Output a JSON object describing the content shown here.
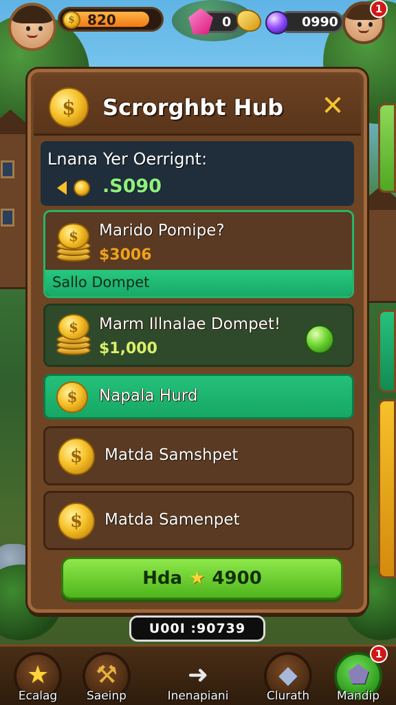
{
  "hud": {
    "gold_amount": "820",
    "gem_amount": "0",
    "orb_amount": "0990",
    "notification_count": "1"
  },
  "panel": {
    "title": "Scrorghbt Hub",
    "balance_label": "Lnana Yer Oerrignt:",
    "balance_value": ".S090",
    "items": [
      {
        "name": "Marido Pomipe?",
        "price": "$3006",
        "sub_label": "Sallo Dompet"
      },
      {
        "name": "Marm Illnalae Dompet!",
        "price": "$1,000"
      },
      {
        "name": "Napala Hurd"
      },
      {
        "name": "Matda Samshpet"
      },
      {
        "name": "Matda Samenpet"
      }
    ],
    "buy_button": {
      "label": "Hda",
      "value": "4900"
    },
    "timer": "U00I :90739"
  },
  "bottom_nav": {
    "items": [
      {
        "label": "Ecalag",
        "icon": "star-icon"
      },
      {
        "label": "Saeinp",
        "icon": "hammer-icon"
      },
      {
        "label": "Inenapiani",
        "icon": "arrow-right-icon"
      },
      {
        "label": "Clurath",
        "icon": "crystal-icon"
      },
      {
        "label": "Mandip",
        "icon": "gem-box-icon",
        "badge": "1"
      }
    ]
  },
  "colors": {
    "panel_wood": "#6e4524",
    "accent_green": "#24c07a",
    "price_orange": "#f0a21a",
    "balance_green": "#8ff07a"
  }
}
